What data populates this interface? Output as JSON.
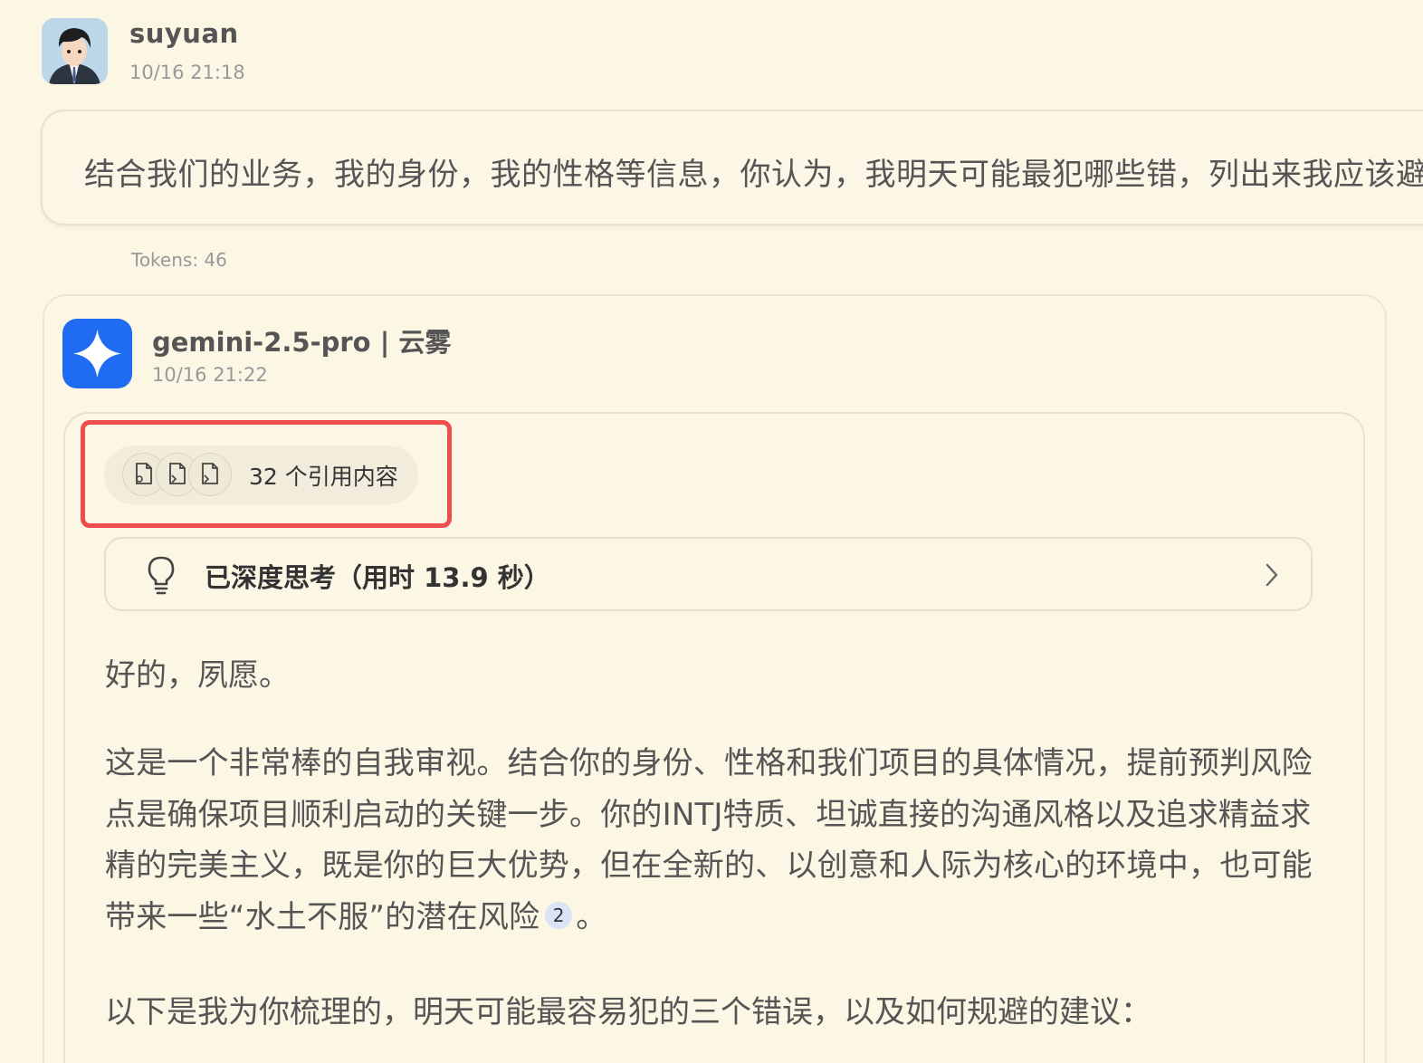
{
  "user": {
    "name": "suyuan",
    "time": "10/16 21:18",
    "message": "结合我们的业务，我的身份，我的性格等信息，你认为，我明天可能最犯哪些错，列出来我应该避",
    "tokens": "Tokens: 46"
  },
  "assistant": {
    "model": "gemini-2.5-pro | 云雾",
    "time": "10/16 21:22",
    "citations_label": "32 个引用内容",
    "thinking_label": "已深度思考（用时 13.9 秒）",
    "greeting": "好的，夙愿。",
    "paragraph": "这是一个非常棒的自我审视。结合你的身份、性格和我们项目的具体情况，提前预判风险点是确保项目顺利启动的关键一步。你的INTJ特质、坦诚直接的沟通风格以及追求精益求精的完美主义，既是你的巨大优势，但在全新的、以创意和人际为核心的环境中，也可能带来一些“水土不服”的潜在风险",
    "ref_number": "2",
    "paragraph_end": "。",
    "intro": "以下是我为你梳理的，明天可能最容易犯的三个错误，以及如何规避的建议："
  },
  "icons": [
    "user-avatar",
    "gemini-sparkle-icon",
    "document-icon",
    "lightbulb-icon",
    "chevron-right-icon"
  ],
  "colors": {
    "background": "#fcf7e4",
    "gemini_blue": "#1f6cf2",
    "highlight_red": "#ee4d4d",
    "ref_badge_bg": "#dbe4f6"
  }
}
